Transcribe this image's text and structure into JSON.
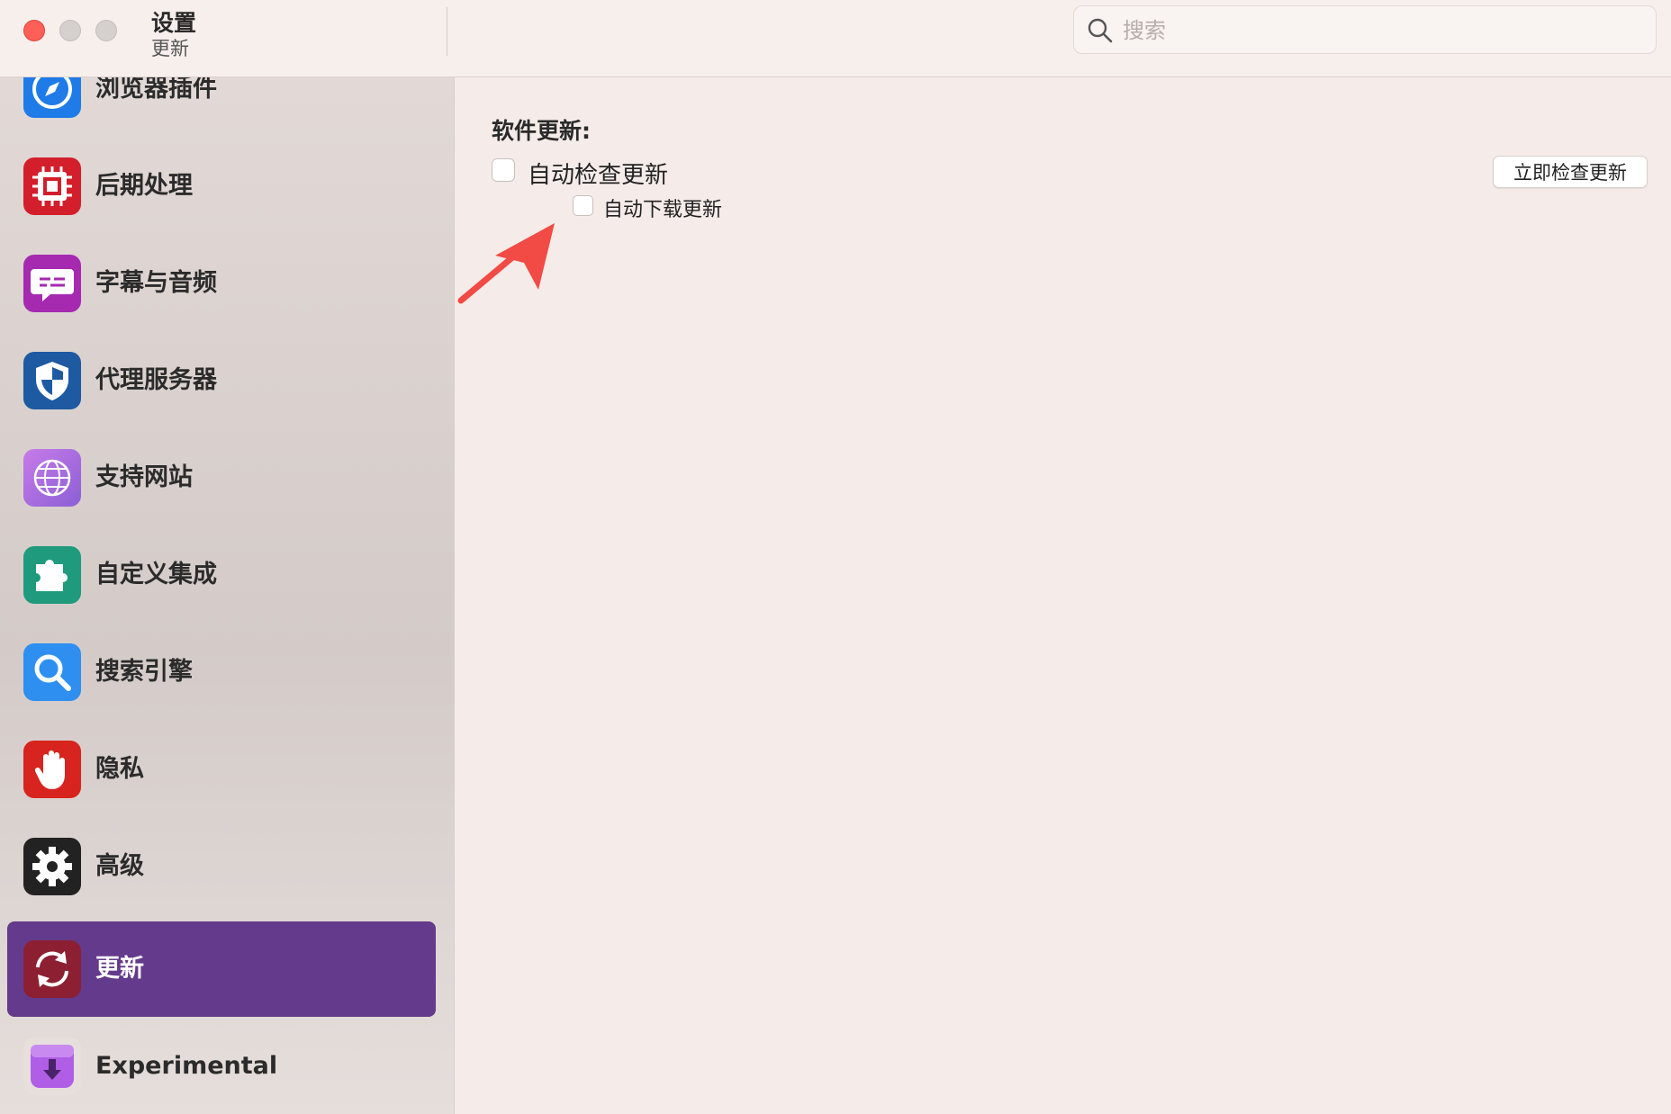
{
  "window": {
    "title": "设置",
    "subtitle": "更新"
  },
  "search": {
    "placeholder": "搜索",
    "value": ""
  },
  "sidebar": {
    "items": [
      {
        "label": "浏览器插件",
        "icon": "compass-icon",
        "color": "#1f7be8"
      },
      {
        "label": "后期处理",
        "icon": "chip-icon",
        "color": "#d21f2b"
      },
      {
        "label": "字幕与音频",
        "icon": "speech-bubble-icon",
        "color": "#a52ab0"
      },
      {
        "label": "代理服务器",
        "icon": "shield-icon",
        "color": "#1d5aa2"
      },
      {
        "label": "支持网站",
        "icon": "globe-icon",
        "color": "#a56be0"
      },
      {
        "label": "自定义集成",
        "icon": "puzzle-icon",
        "color": "#1f9a7d"
      },
      {
        "label": "搜索引擎",
        "icon": "magnifier-icon",
        "color": "#2e8ff0"
      },
      {
        "label": "隐私",
        "icon": "hand-icon",
        "color": "#d7241e"
      },
      {
        "label": "高级",
        "icon": "gear-icon",
        "color": "#222222"
      },
      {
        "label": "更新",
        "icon": "refresh-icon",
        "color": "#8c2032",
        "selected": true
      },
      {
        "label": "Experimental",
        "icon": "download-box-icon",
        "color": "#b05ee6"
      }
    ],
    "selected_color": "#643a8c"
  },
  "main": {
    "section_title": "软件更新:",
    "auto_check_label": "自动检查更新",
    "auto_check_checked": false,
    "auto_download_label": "自动下载更新",
    "auto_download_checked": false,
    "check_now_button": "立即检查更新"
  },
  "colors": {
    "close": "#fe5f57",
    "arrow": "#f24a44"
  }
}
